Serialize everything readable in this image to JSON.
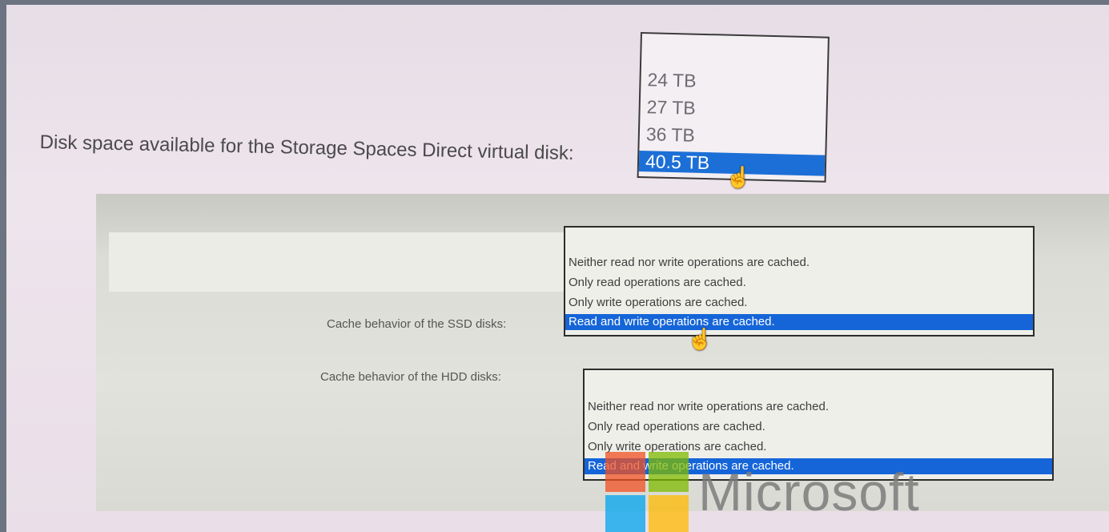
{
  "question1": {
    "label": "Disk space available for the Storage Spaces Direct virtual disk:",
    "options": [
      "24 TB",
      "27 TB",
      "36 TB",
      "40.5 TB"
    ],
    "selected_index": 3
  },
  "ssd_cache": {
    "label": "Cache behavior of the SSD disks:",
    "options": [
      "Neither read nor write operations are cached.",
      "Only read operations are cached.",
      "Only write operations are cached.",
      "Read and write operations are cached."
    ],
    "selected_index": 3
  },
  "hdd_cache": {
    "label": "Cache behavior of the HDD disks:",
    "options": [
      "Neither read nor write operations are cached.",
      "Only read operations are cached.",
      "Only write operations are cached.",
      "Read and write operations are cached."
    ],
    "selected_index": 3
  },
  "watermark": {
    "brand": "Microsoft"
  },
  "colors": {
    "selection": "#1565d8",
    "border": "#2d2d2d"
  },
  "icons": {
    "cursor": "hand-pointer-icon"
  }
}
